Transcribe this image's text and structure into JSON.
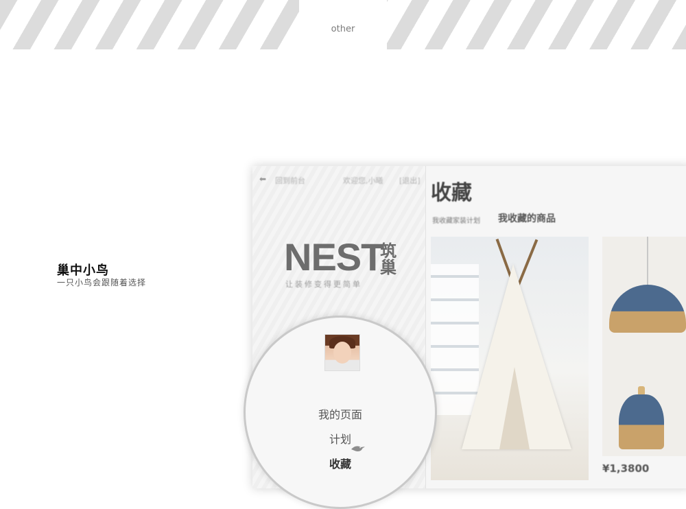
{
  "header": {
    "section_label": "other"
  },
  "caption": {
    "title": "巢中小鸟",
    "subtitle": "一只小鸟会跟随着选择"
  },
  "app": {
    "top_bar": {
      "back_label": "回到前台",
      "welcome": "欢迎您,小曦",
      "logout": "[退出]"
    },
    "logo": {
      "text": "NEST",
      "chinese": "筑巢",
      "slogan": "让装修变得更简单"
    },
    "menu": {
      "items": [
        {
          "label": "我的页面"
        },
        {
          "label": "计划"
        },
        {
          "label": "收藏"
        }
      ],
      "active_index": 2
    },
    "main": {
      "title": "收藏",
      "tab_secondary": "我收藏家装计划",
      "tab_active": "我收藏的商品",
      "products": [
        {
          "price": ""
        },
        {
          "price": "¥1,3800"
        }
      ]
    }
  },
  "colors": {
    "stripe": "#dcdcdc",
    "logo": "#6d6d6d",
    "lamp_blue": "#4c6a8e",
    "lamp_wood": "#c9a26a"
  },
  "icons": {
    "back": "left-arrow-icon",
    "bird": "bird-icon"
  }
}
